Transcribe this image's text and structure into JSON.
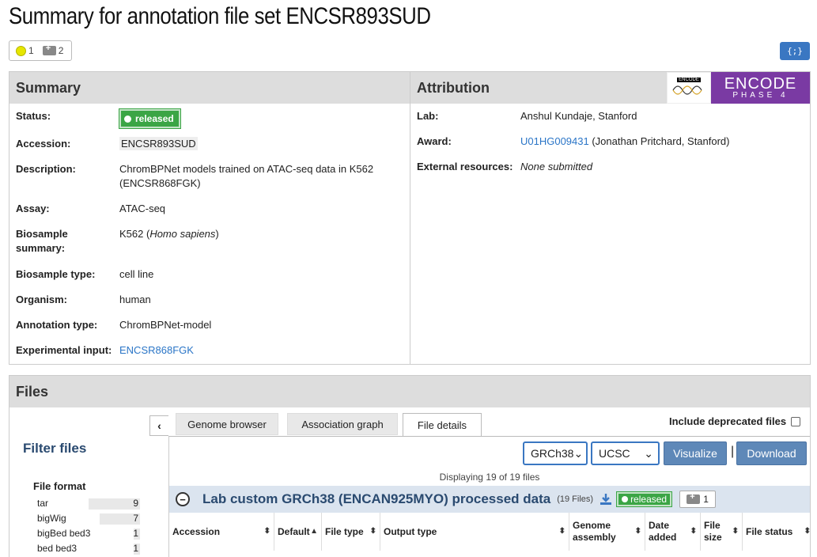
{
  "page": {
    "title": "Summary for annotation file set ENCSR893SUD"
  },
  "audit": {
    "yellow_count": "1",
    "ambulance_count": "2"
  },
  "json_button": "{;}",
  "summary": {
    "header": "Summary",
    "fields": [
      {
        "key": "Status:",
        "value": "released"
      },
      {
        "key": "Accession:",
        "value": "ENCSR893SUD"
      },
      {
        "key": "Description:",
        "value": "ChromBPNet models trained on ATAC-seq data in K562 (ENCSR868FGK)"
      },
      {
        "key": "Assay:",
        "value": "ATAC-seq"
      },
      {
        "key": "Biosample summary:",
        "value_prefix": "K562 (",
        "value_italic": "Homo sapiens",
        "value_suffix": ")"
      },
      {
        "key": "Biosample type:",
        "value": "cell line"
      },
      {
        "key": "Organism:",
        "value": "human"
      },
      {
        "key": "Annotation type:",
        "value": "ChromBPNet-model"
      },
      {
        "key": "Experimental input:",
        "value": "ENCSR868FGK"
      }
    ]
  },
  "attribution": {
    "header": "Attribution",
    "logo_big": "ENCODE",
    "logo_small": "PHASE 4",
    "logo_mini": "ENCODE",
    "fields": [
      {
        "key": "Lab:",
        "value": "Anshul Kundaje, Stanford"
      },
      {
        "key": "Award:",
        "link": "U01HG009431",
        "value": " (Jonathan Pritchard, Stanford)"
      },
      {
        "key": "External resources:",
        "value": "None submitted"
      }
    ]
  },
  "files": {
    "header": "Files",
    "filter_title": "Filter files",
    "facet_title": "File format",
    "facets": [
      {
        "label": "tar",
        "count": "9",
        "fraction": 0.5
      },
      {
        "label": "bigWig",
        "count": "7",
        "fraction": 0.39
      },
      {
        "label": "bigBed bed3",
        "count": "1",
        "fraction": 0.06
      },
      {
        "label": "bed bed3",
        "count": "1",
        "fraction": 0.06
      }
    ],
    "collapse_label": "‹",
    "tabs": [
      "Genome browser",
      "Association graph",
      "File details"
    ],
    "active_tab": "File details",
    "include_deprecated": "Include deprecated files",
    "assembly_select": "GRCh38",
    "browser_select": "UCSC",
    "visualize": "Visualize",
    "separator": "|",
    "download": "Download",
    "displaying": "Displaying 19 of 19 files",
    "dataset": {
      "title": "Lab custom GRCh38 (ENCAN925MYO) processed data",
      "count": "(19 Files)",
      "status": "released",
      "audit_count": "1"
    },
    "columns": [
      "Accession",
      "Default",
      "File type",
      "Output type",
      "Genome assembly",
      "Date added",
      "File size",
      "File status"
    ]
  },
  "colors": {
    "accent": "#3a77c2",
    "released": "#3ba545",
    "encode_purple": "#7a3aa3"
  }
}
